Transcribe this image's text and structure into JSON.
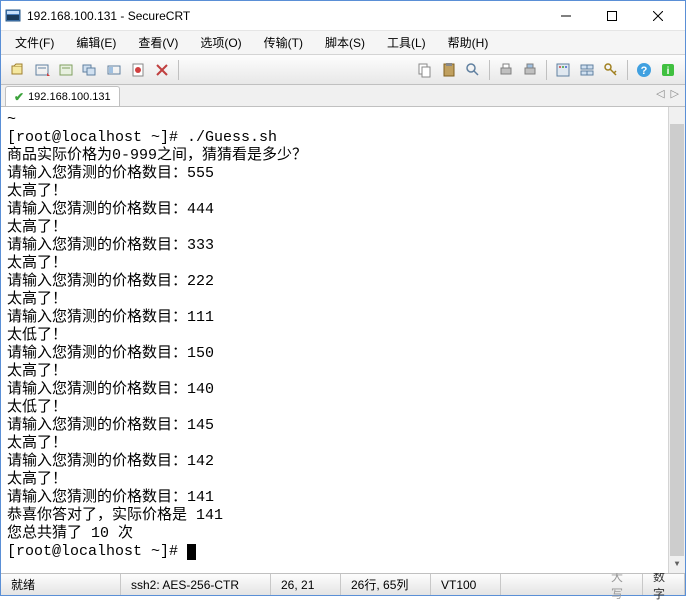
{
  "window": {
    "title": "192.168.100.131 - SecureCRT"
  },
  "menu": {
    "file": "文件(F)",
    "edit": "编辑(E)",
    "view": "查看(V)",
    "options": "选项(O)",
    "transfer": "传输(T)",
    "script": "脚本(S)",
    "tools": "工具(L)",
    "help": "帮助(H)"
  },
  "tab": {
    "label": "192.168.100.131"
  },
  "terminal": {
    "lines": [
      "~",
      "[root@localhost ~]# ./Guess.sh",
      "商品实际价格为0-999之间，猜猜看是多少？",
      "请输入您猜测的价格数目：555",
      "太高了！",
      "请输入您猜测的价格数目：444",
      "太高了！",
      "请输入您猜测的价格数目：333",
      "太高了！",
      "请输入您猜测的价格数目：222",
      "太高了！",
      "请输入您猜测的价格数目：111",
      "太低了！",
      "请输入您猜测的价格数目：150",
      "太高了！",
      "请输入您猜测的价格数目：140",
      "太低了！",
      "请输入您猜测的价格数目：145",
      "太高了！",
      "请输入您猜测的价格数目：142",
      "太高了！",
      "请输入您猜测的价格数目：141",
      "恭喜你答对了，实际价格是 141",
      "您总共猜了 10 次"
    ],
    "prompt": "[root@localhost ~]# "
  },
  "status": {
    "ready": "就绪",
    "ssh": "ssh2: AES-256-CTR",
    "pos1": "26,  21",
    "pos2": "26行, 65列",
    "vt": "VT100",
    "caps": "大写",
    "num": "数字"
  }
}
